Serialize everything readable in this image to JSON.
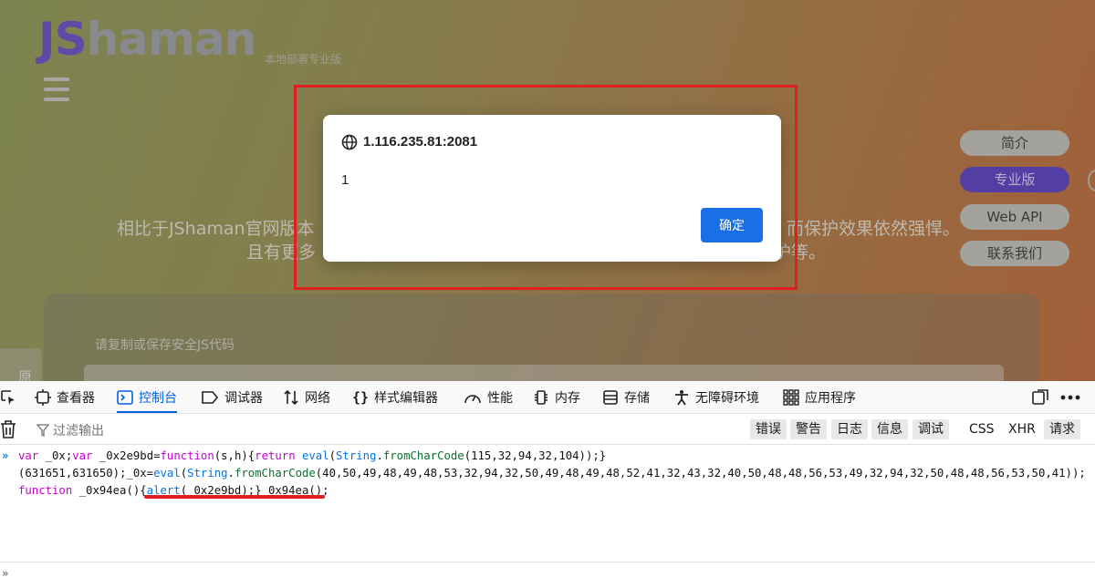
{
  "page": {
    "logo_prefix": "JS",
    "logo_suffix": "haman",
    "logo_sub": "本地部署专业版",
    "hero_line1": "相比于JShaman官网版本",
    "hero_line2": "且有更多",
    "hero_line1_end": "而保护效果依然强悍。",
    "hero_line2_end": "护等。",
    "nav": [
      "简介",
      "专业版",
      "Web API",
      "联系我们"
    ],
    "panel_label": "请复制或保存安全JS代码",
    "left_tab": "原"
  },
  "dialog": {
    "origin": "1.116.235.81:2081",
    "message": "1",
    "ok_label": "确定"
  },
  "devtools": {
    "tabs": [
      "查看器",
      "控制台",
      "调试器",
      "网络",
      "样式编辑器",
      "性能",
      "内存",
      "存储",
      "无障碍环境",
      "应用程序"
    ],
    "active_tab": "控制台",
    "filter_placeholder": "过滤输出",
    "levels": [
      "错误",
      "警告",
      "日志",
      "信息",
      "调试"
    ],
    "types": [
      "CSS",
      "XHR",
      "请求"
    ],
    "console_lines": [
      "var _0x;var _0x2e9bd=function(s,h){return eval(String.fromCharCode(115,32,94,32,104));}",
      "(631651,631650);_0x=eval(String.fromCharCode(40,50,49,48,49,48,53,32,94,32,50,49,48,49,48,52,41,32,43,32,40,50,48,48,56,53,49,32,94,32,50,48,48,56,53,50,41));",
      "function _0x94ea(){alert(_0x2e9bd);}_0x94ea();"
    ]
  },
  "colors": {
    "accent": "#0060df",
    "highlight": "#e02020",
    "dialog_button": "#1a6fe6",
    "brand_purple": "#5a3fc0"
  }
}
